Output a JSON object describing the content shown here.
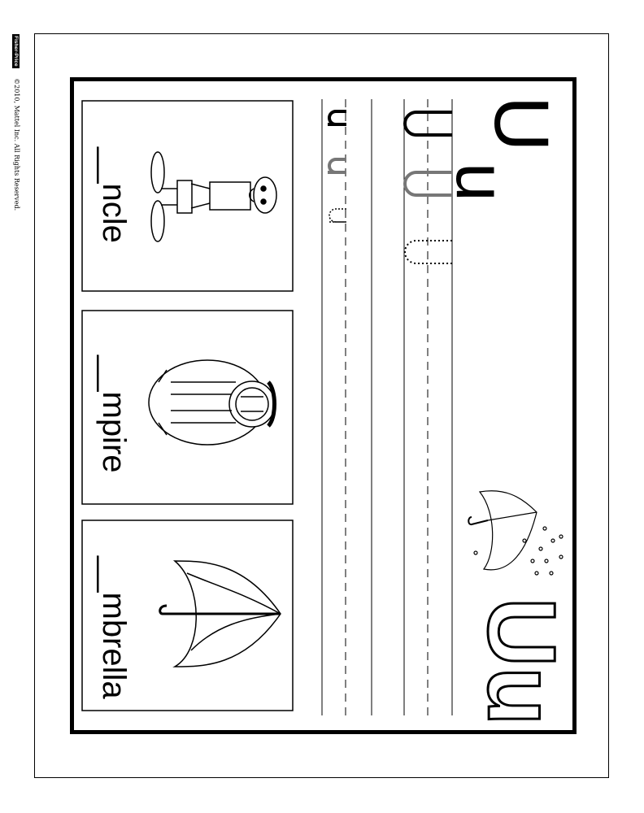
{
  "sidebar": {
    "brand": "Fisher-Price",
    "copyright": "©2010, Mattel Inc.    All Rights Reserved."
  },
  "header": {
    "letter_upper": "U",
    "letter_lower": "u",
    "outline_letters": "Uu"
  },
  "practice": {
    "upper_row": [
      "U",
      "U",
      "U"
    ],
    "lower_row": [
      "u",
      "u",
      "u"
    ]
  },
  "pictures": [
    {
      "word": "__ncle",
      "picture": "uncle"
    },
    {
      "word": "__mpire",
      "picture": "umpire"
    },
    {
      "word": "__mbrella",
      "picture": "umbrella"
    }
  ]
}
